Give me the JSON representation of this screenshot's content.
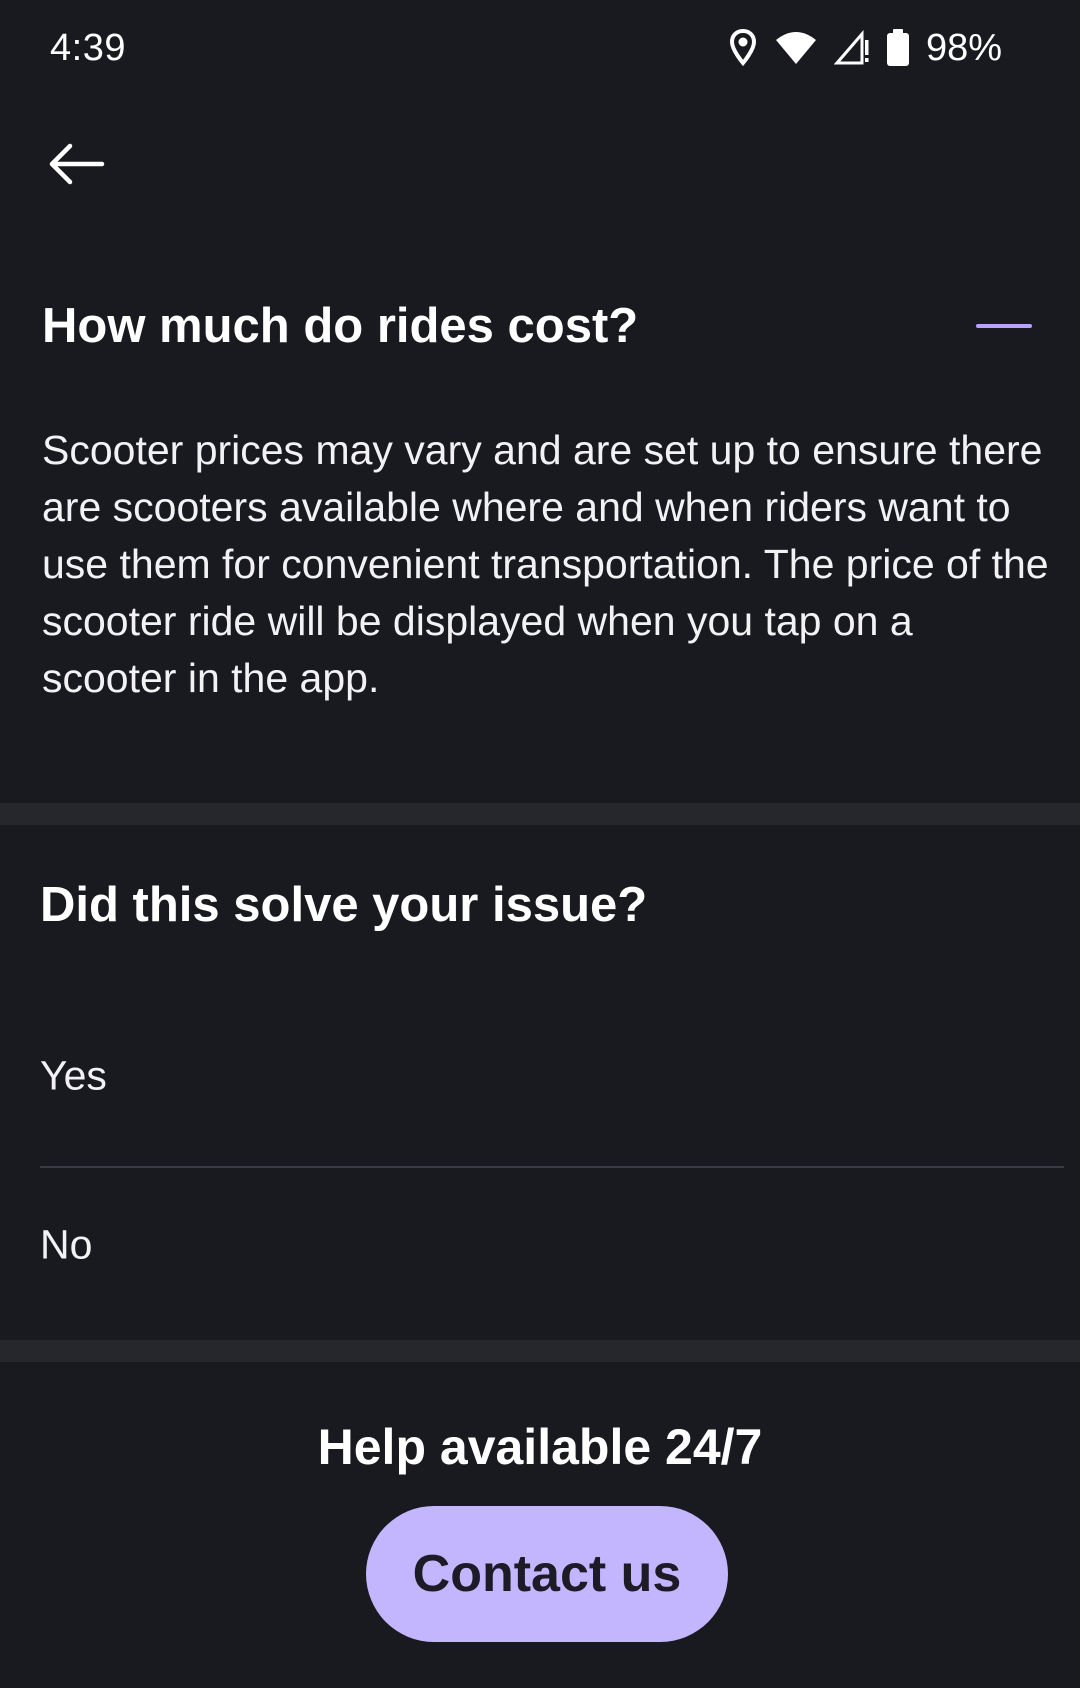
{
  "status_bar": {
    "time": "4:39",
    "battery_percent": "98%",
    "icons": [
      "location-icon",
      "wifi-icon",
      "cell-signal-icon",
      "battery-icon"
    ]
  },
  "nav": {
    "back_icon": "arrow-left-icon"
  },
  "faq": {
    "question": "How much do rides cost?",
    "answer": "Scooter prices may vary and are set up to ensure there are scooters available where and when riders want to use them for convenient transportation. The price of the scooter ride will be displayed when you tap on a scooter in the app.",
    "toggle_icon": "minus-icon",
    "expanded": true
  },
  "feedback": {
    "title": "Did this solve your issue?",
    "options": [
      "Yes",
      "No"
    ]
  },
  "help": {
    "title": "Help available 24/7",
    "contact_label": "Contact us"
  },
  "colors": {
    "background": "#191920",
    "divider": "#26262d",
    "accent": "#b7a3ff",
    "button": "#c4b5ff",
    "button_text": "#1d1b26"
  }
}
